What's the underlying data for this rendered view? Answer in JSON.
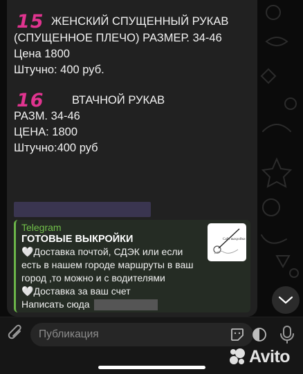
{
  "message": {
    "block1": {
      "number": "15",
      "line1": "ЖЕНСКИЙ СПУЩЕННЫЙ РУКАВ",
      "line2": "(СПУЩЕННОЕ ПЛЕЧО) РАЗМЕР. 34-46",
      "line3": "Цена 1800",
      "line4": "Штучно: 400 руб."
    },
    "block2": {
      "number": "16",
      "line1": "ВТАЧНОЙ РУКАВ",
      "line2": "РАЗМ. 34-46",
      "line3": "ЦЕНА: 1800",
      "line4": "Штучно:400 руб"
    }
  },
  "link_preview": {
    "site": "Telegram",
    "title": "ГОТОВЫЕ ВЫКРОЙКИ",
    "desc_line1": "Доставка почтой,  СДЭК или если",
    "desc_line2": "есть в нашем городе маршруты в ваш",
    "desc_line3": "город ,то можно и с водителями",
    "desc_line4": "Доставка за ваш счет",
    "desc_line5": "Написать  сюда",
    "heart_glyph": "🤍",
    "thumb_text": "Сайт выкройки"
  },
  "composer": {
    "placeholder": "Публикация"
  },
  "watermark": {
    "brand": "Avito"
  },
  "colors": {
    "accent_number": "#e0348f",
    "preview_accent": "#6bb449",
    "bubble": "#212121"
  }
}
